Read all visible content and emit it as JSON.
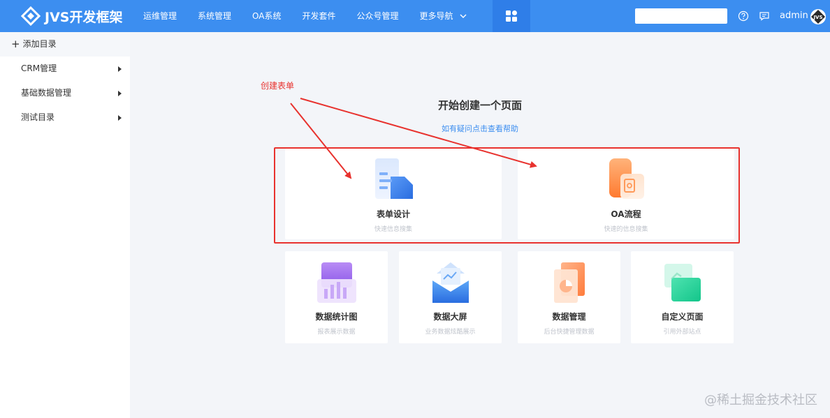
{
  "header": {
    "logo_text": "JVS开发框架",
    "nav": [
      "运维管理",
      "系统管理",
      "OA系统",
      "开发套件",
      "公众号管理"
    ],
    "more_label": "更多导航",
    "search_placeholder": "",
    "username": "admin",
    "avatar_text": "JVS"
  },
  "sidebar": {
    "add_label": "添加目录",
    "items": [
      {
        "label": "CRM管理"
      },
      {
        "label": "基础数据管理"
      },
      {
        "label": "测试目录"
      }
    ]
  },
  "main": {
    "heading": "开始创建一个页面",
    "help_link": "如有疑问点击查看帮助",
    "big_cards": [
      {
        "title": "表单设计",
        "subtitle": "快速信息搜集",
        "icon": "form-icon"
      },
      {
        "title": "OA流程",
        "subtitle": "快速的信息搜集",
        "icon": "workflow-icon"
      }
    ],
    "small_cards": [
      {
        "title": "数据统计图",
        "subtitle": "报表展示数据",
        "icon": "chart-icon"
      },
      {
        "title": "数据大屏",
        "subtitle": "业务数据炫酷展示",
        "icon": "screen-icon"
      },
      {
        "title": "数据管理",
        "subtitle": "后台快捷管理数据",
        "icon": "data-manage-icon"
      },
      {
        "title": "自定义页面",
        "subtitle": "引用外部站点",
        "icon": "custom-page-icon"
      }
    ]
  },
  "annotation": {
    "text": "创建表单",
    "color": "#e8322e"
  },
  "watermark": "@稀土掘金技术社区",
  "colors": {
    "primary": "#3c8ef0",
    "apps_active": "#2f7ee8",
    "annotation_red": "#e8322e"
  }
}
